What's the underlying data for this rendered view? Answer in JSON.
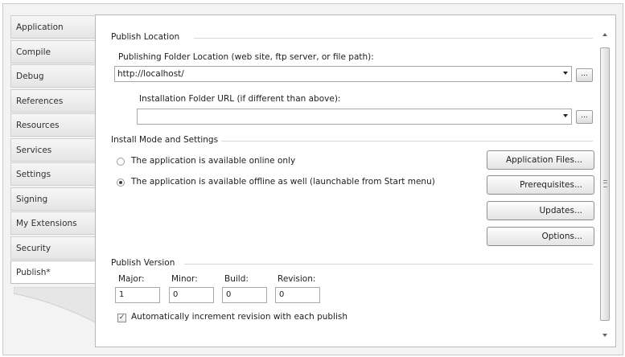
{
  "tabs": [
    "Application",
    "Compile",
    "Debug",
    "References",
    "Resources",
    "Services",
    "Settings",
    "Signing",
    "My Extensions",
    "Security",
    "Publish*"
  ],
  "active_tab": "Publish*",
  "publish_location": {
    "header": "Publish Location",
    "folder_label": "Publishing Folder Location (web site, ftp server, or file path):",
    "folder_value": "http://localhost/",
    "install_url_label": "Installation Folder URL (if different than above):",
    "install_url_value": "",
    "browse_label": "..."
  },
  "install_mode": {
    "header": "Install Mode and Settings",
    "online_label": "The application is available online only",
    "offline_label": "The application is available offline as well (launchable from Start menu)",
    "selected": "offline",
    "buttons": [
      "Application Files...",
      "Prerequisites...",
      "Updates...",
      "Options..."
    ]
  },
  "publish_version": {
    "header": "Publish Version",
    "major_label": "Major:",
    "minor_label": "Minor:",
    "build_label": "Build:",
    "revision_label": "Revision:",
    "major": "1",
    "minor": "0",
    "build": "0",
    "revision": "0",
    "auto_increment_label": "Automatically increment revision with each publish",
    "auto_increment_checked": true
  }
}
